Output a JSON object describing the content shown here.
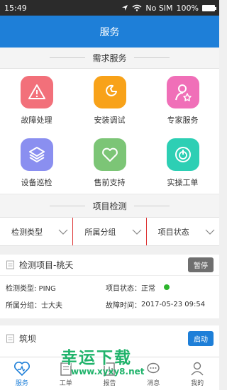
{
  "status": {
    "time": "15:49",
    "carrier": "No SIM",
    "battery": "100%"
  },
  "header": {
    "title": "服务"
  },
  "sections": {
    "demand_title": "需求服务",
    "project_title": "项目检测"
  },
  "services": [
    {
      "label": "故障处理",
      "color": "#f2707a",
      "icon": "warning-icon"
    },
    {
      "label": "安装调试",
      "color": "#f8a219",
      "icon": "wrench-icon"
    },
    {
      "label": "专家服务",
      "color": "#f06fb8",
      "icon": "expert-icon"
    },
    {
      "label": "设备巡检",
      "color": "#8a8ff0",
      "icon": "layers-icon"
    },
    {
      "label": "售前支持",
      "color": "#7cc576",
      "icon": "heart-icon"
    },
    {
      "label": "实操工单",
      "color": "#2dcfb4",
      "icon": "power-icon"
    }
  ],
  "filters": [
    "检测类型",
    "所属分组",
    "项目状态"
  ],
  "project1": {
    "name": "检测项目-桃夭",
    "button": "暂停",
    "type_label": "检测类型: PING",
    "status_label": "项目状态：",
    "status_value": "正常",
    "group_label": "所属分组：士大夫",
    "fault_label": "故障时间：",
    "fault_time": "2017-05-23 09:54"
  },
  "project2": {
    "name": "筑坝",
    "button": "启动"
  },
  "tabs": [
    "服务",
    "工单",
    "报告",
    "消息",
    "我的"
  ],
  "watermark": {
    "big": "幸运下载",
    "url": "www.xyxy8.net"
  }
}
